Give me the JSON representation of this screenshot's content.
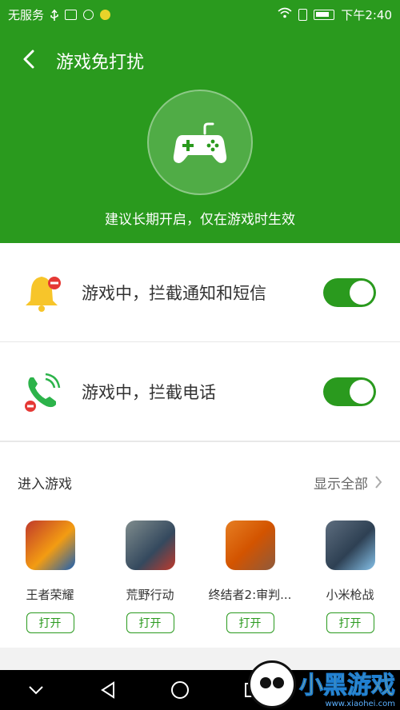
{
  "status_bar": {
    "carrier": "无服务",
    "time": "下午2:40"
  },
  "header": {
    "title": "游戏免打扰",
    "subtitle": "建议长期开启，仅在游戏时生效"
  },
  "settings": [
    {
      "label": "游戏中，拦截通知和短信",
      "enabled": true
    },
    {
      "label": "游戏中，拦截电话",
      "enabled": true
    }
  ],
  "games_section": {
    "title": "进入游戏",
    "show_all": "显示全部",
    "items": [
      {
        "name": "王者荣耀",
        "button": "打开"
      },
      {
        "name": "荒野行动",
        "button": "打开"
      },
      {
        "name": "终结者2:审判...",
        "button": "打开"
      },
      {
        "name": "小米枪战",
        "button": "打开"
      }
    ]
  },
  "watermark": {
    "brand": "小黑游戏",
    "url": "www.xiaohei.com"
  },
  "colors": {
    "primary_green": "#2a9a1e",
    "text_dark": "#333333",
    "bell_yellow": "#f7c52a",
    "badge_red": "#e53935",
    "phone_green": "#2cb34a"
  }
}
